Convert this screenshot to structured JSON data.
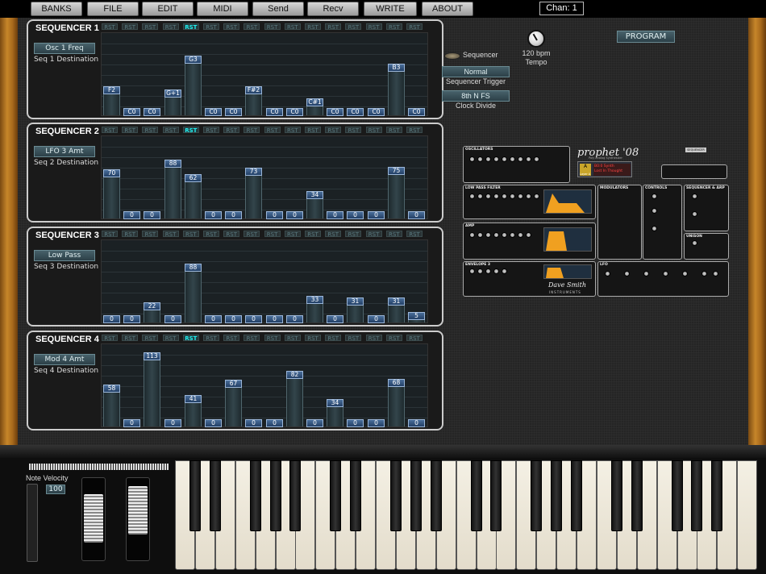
{
  "menu": [
    "BANKS",
    "FILE",
    "EDIT",
    "MIDI",
    "Send",
    "Recv",
    "WRITE",
    "ABOUT"
  ],
  "channel": "Chan: 1",
  "program_label": "PROGRAM",
  "rst_label": "RST",
  "sequencers": [
    {
      "title": "SEQUENCER 1",
      "dest": "Osc 1 Freq",
      "dest_label": "Seq 1 Destination",
      "active_rst": 4,
      "values": [
        "F2",
        "C0",
        "C0",
        "G+1",
        "G3",
        "C0",
        "C0",
        "F#2",
        "C0",
        "C0",
        "C#1",
        "C0",
        "C0",
        "C0",
        "B3",
        "C0"
      ],
      "levels": [
        0.29,
        0.0,
        0.0,
        0.25,
        0.7,
        0.0,
        0.0,
        0.29,
        0.0,
        0.0,
        0.13,
        0.0,
        0.0,
        0.0,
        0.59,
        0.0
      ]
    },
    {
      "title": "SEQUENCER 2",
      "dest": "LFO 3 Amt",
      "dest_label": "Seq 2 Destination",
      "active_rst": 4,
      "values": [
        "70",
        "0",
        "0",
        "88",
        "62",
        "0",
        "0",
        "73",
        "0",
        "0",
        "34",
        "0",
        "0",
        "0",
        "75",
        "0"
      ],
      "levels": [
        0.56,
        0.0,
        0.0,
        0.69,
        0.49,
        0.0,
        0.0,
        0.58,
        0.0,
        0.0,
        0.27,
        0.0,
        0.0,
        0.0,
        0.59,
        0.0
      ]
    },
    {
      "title": "SEQUENCER 3",
      "dest": "Low Pass",
      "dest_label": "Seq 3 Destination",
      "active_rst": -1,
      "values": [
        "0",
        "0",
        "22",
        "0",
        "88",
        "0",
        "0",
        "0",
        "0",
        "0",
        "33",
        "0",
        "31",
        "0",
        "31",
        "5"
      ],
      "levels": [
        0.0,
        0.0,
        0.17,
        0.0,
        0.69,
        0.0,
        0.0,
        0.0,
        0.0,
        0.0,
        0.26,
        0.0,
        0.24,
        0.0,
        0.24,
        0.04
      ]
    },
    {
      "title": "SEQUENCER 4",
      "dest": "Mod 4 Amt",
      "dest_label": "Seq 4 Destination",
      "active_rst": 4,
      "values": [
        "58",
        "0",
        "113",
        "0",
        "41",
        "0",
        "67",
        "0",
        "0",
        "82",
        "0",
        "34",
        "0",
        "0",
        "68",
        "0"
      ],
      "levels": [
        0.46,
        0.0,
        0.89,
        0.0,
        0.32,
        0.0,
        0.53,
        0.0,
        0.0,
        0.65,
        0.0,
        0.27,
        0.0,
        0.0,
        0.54,
        0.0
      ]
    }
  ],
  "seq_controls": {
    "sequencer_label": "Sequencer",
    "trigger_value": "Normal",
    "trigger_label": "Sequencer Trigger",
    "clock_value": "8th N FS",
    "clock_label": "Clock Divide",
    "tempo_value": "120 bpm",
    "tempo_label": "Tempo"
  },
  "synth": {
    "brand": "prophet '08",
    "subtitle": "Poly Analog Synthesizer",
    "maker": "Dave Smith",
    "maker_sub": "INSTRUMENTS",
    "patch_name": "Lost In Thought",
    "bank_code": "A",
    "bank_label": "Layer A",
    "patch_number": "B0:0  Synth",
    "sections": {
      "oscillators": "OSCILLATORS",
      "lpf": "LOW PASS FILTER",
      "amp": "AMP",
      "env3": "ENVELOPE 3",
      "modulators": "MODULATORS",
      "controls": "CONTROLS",
      "seqarp": "SEQUENCER & ARP",
      "unison": "UNISON",
      "lfo": "LFO"
    },
    "seq_badge": "SEQUENCER"
  },
  "keyboard": {
    "note_velocity_label": "Note Velocity",
    "note_velocity_value": "100"
  }
}
